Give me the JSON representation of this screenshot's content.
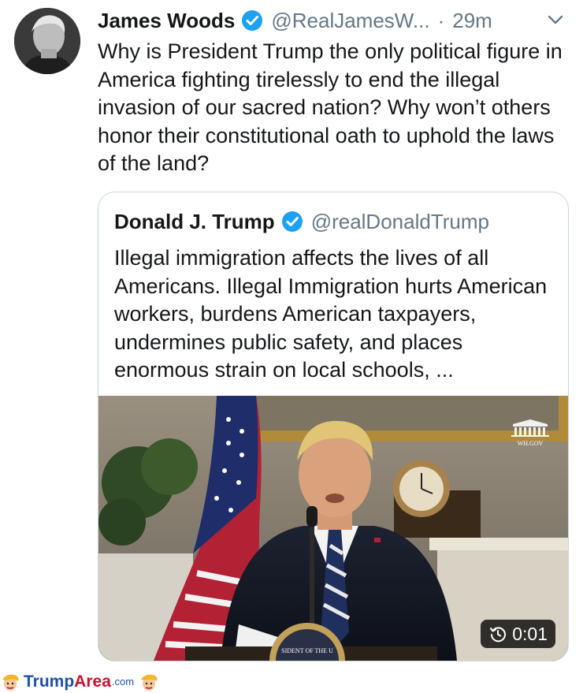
{
  "tweet": {
    "author_name": "James Woods",
    "handle": "@RealJamesW...",
    "separator": "·",
    "time": "29m",
    "text": "Why is President Trump the only political figure in America fighting tirelessly to end the illegal invasion of our sacred nation? Why won’t others honor their constitutional oath to uphold the laws of the land?",
    "avatar_icon": "profile-photo",
    "menu_icon": "chevron-down-icon"
  },
  "quoted_tweet": {
    "author_name": "Donald J. Trump",
    "handle": "@realDonaldTrump",
    "text": "Illegal immigration affects the lives of all Americans. Illegal Immigration hurts American workers, burdens American taxpayers, undermines public safety, and places enormous strain on local schools, ...",
    "video": {
      "watermark": "WH.GOV",
      "duration": "0:01",
      "duration_icon": "replay-icon",
      "seal_text": "SIDENT OF THE U"
    }
  },
  "watermark": {
    "brand_part1": "Trump",
    "brand_part2": "Area",
    "brand_suffix": ".com"
  },
  "colors": {
    "verified_blue": "#1da1f2",
    "secondary_text": "#657786",
    "border": "#ccd6dd"
  }
}
